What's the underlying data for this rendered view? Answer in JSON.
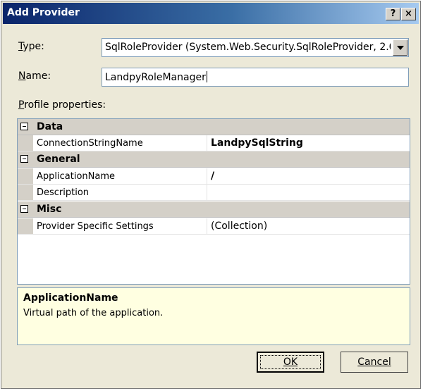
{
  "window": {
    "title": "Add Provider",
    "help_button": "?",
    "close_button": "×"
  },
  "form": {
    "type_label": "Type:",
    "type_value": "SqlRoleProvider (System.Web.Security.SqlRoleProvider, 2.0.",
    "name_label": "Name:",
    "name_value": "LandpyRoleManager",
    "profile_label": "Profile properties:"
  },
  "grid": {
    "rows": [
      {
        "kind": "category",
        "name": "Data"
      },
      {
        "kind": "property",
        "name": "ConnectionStringName",
        "value": "LandpySqlString",
        "bold": true
      },
      {
        "kind": "category",
        "name": "General"
      },
      {
        "kind": "property",
        "name": "ApplicationName",
        "value": "/",
        "bold": true
      },
      {
        "kind": "property",
        "name": "Description",
        "value": ""
      },
      {
        "kind": "category",
        "name": "Misc"
      },
      {
        "kind": "property",
        "name": "Provider Specific Settings",
        "value": "(Collection)"
      }
    ]
  },
  "description": {
    "title": "ApplicationName",
    "text": "Virtual path of the application."
  },
  "buttons": {
    "ok": "OK",
    "cancel": "Cancel"
  }
}
